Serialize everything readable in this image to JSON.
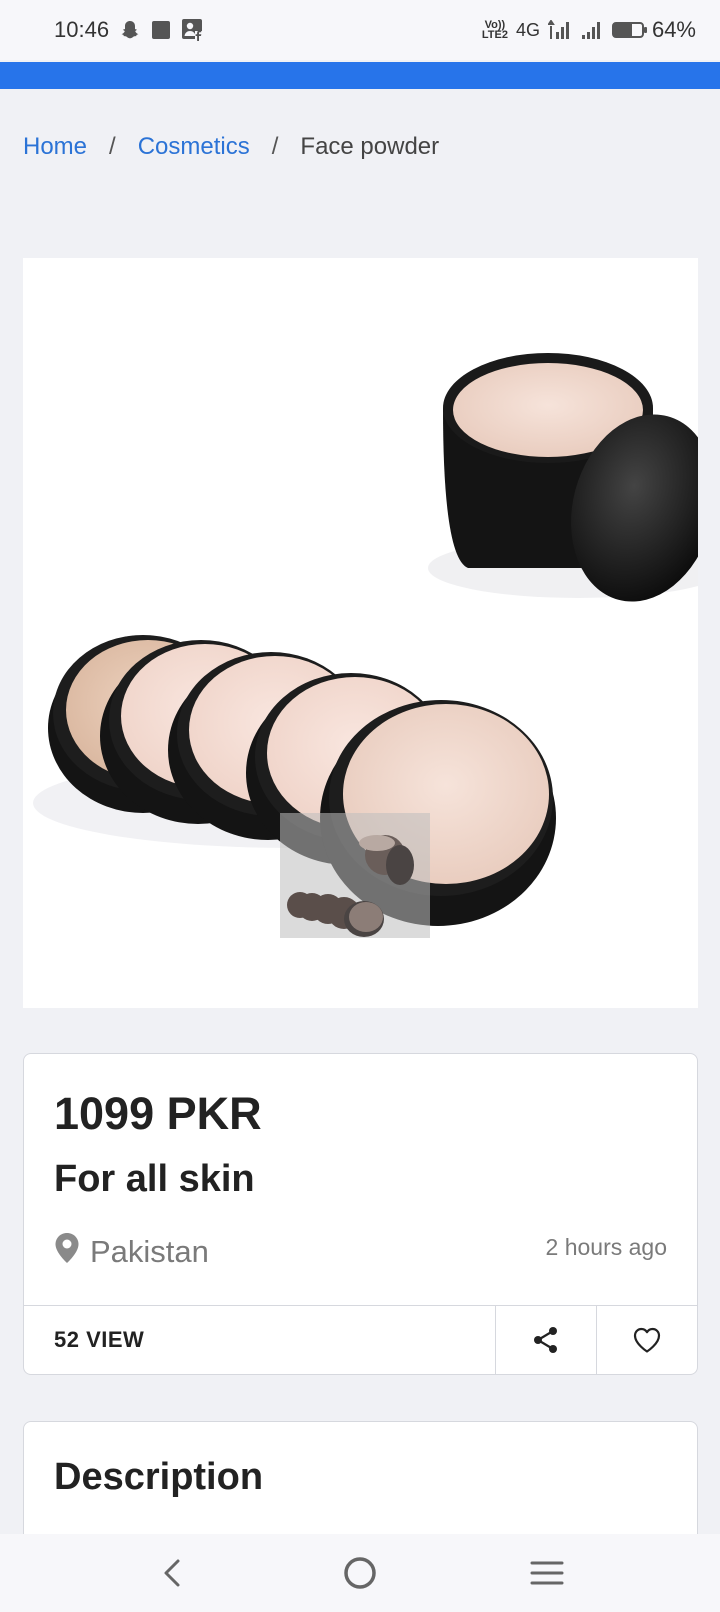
{
  "status_bar": {
    "time": "10:46",
    "left_icons": [
      "snapchat-icon",
      "square-notification-icon",
      "facebook-contact-icon"
    ],
    "volte_top": "Vo))",
    "volte_bottom": "LTE2",
    "network": "4G",
    "battery_percent": "64%",
    "battery_level": 0.64
  },
  "accent_color": "#2774ea",
  "breadcrumb": {
    "home": "Home",
    "separator": "/",
    "category": "Cosmetics",
    "current": "Face powder"
  },
  "product": {
    "image_icon": "face-powder-compacts-image",
    "price": "1099 PKR",
    "subtitle": "For all skin",
    "location": "Pakistan",
    "time_ago": "2 hours ago",
    "views": "52 VIEW"
  },
  "actions": {
    "share_icon": "share-icon",
    "favorite_icon": "heart-icon"
  },
  "description": {
    "title": "Description"
  },
  "nav": {
    "back_icon": "back-icon",
    "home_icon": "home-circle-icon",
    "menu_icon": "menu-icon"
  }
}
